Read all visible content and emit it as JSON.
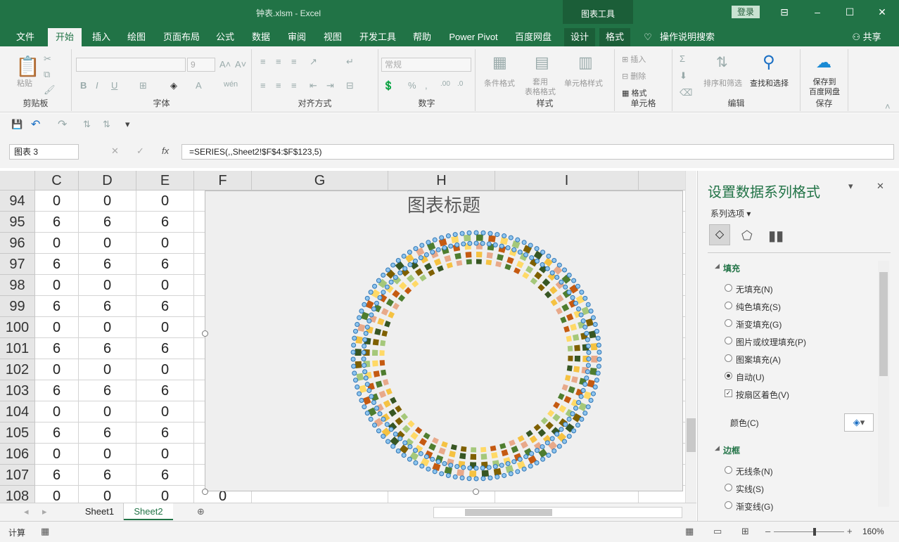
{
  "window": {
    "title": "钟表.xlsm  -  Excel",
    "chart_tools": "图表工具",
    "login": "登录"
  },
  "tabs": [
    "文件",
    "开始",
    "插入",
    "绘图",
    "页面布局",
    "公式",
    "数据",
    "审阅",
    "视图",
    "开发工具",
    "帮助",
    "Power Pivot",
    "百度网盘",
    "设计",
    "格式"
  ],
  "tell_me": "操作说明搜索",
  "share": "共享",
  "ribbon": {
    "clipboard": {
      "label": "剪贴板",
      "paste": "粘贴"
    },
    "font": {
      "label": "字体",
      "size": "9"
    },
    "align": {
      "label": "对齐方式"
    },
    "number": {
      "label": "数字",
      "format": "常规"
    },
    "styles": {
      "label": "样式",
      "cond": "条件格式",
      "table": "套用\n表格格式",
      "cell": "单元格样式"
    },
    "cells": {
      "label": "单元格",
      "insert": "插入",
      "delete": "删除",
      "format": "格式"
    },
    "edit": {
      "label": "编辑",
      "sort": "排序和筛选",
      "find": "查找和选择"
    },
    "save": {
      "label": "保存",
      "btn": "保存到\n百度网盘"
    }
  },
  "namebox": "图表 3",
  "formula": "=SERIES(,,Sheet2!$F$4:$F$123,5)",
  "columns": [
    "C",
    "D",
    "E",
    "F",
    "G",
    "H",
    "I"
  ],
  "rows": [
    {
      "n": "94",
      "c": "0",
      "d": "0",
      "e": "0"
    },
    {
      "n": "95",
      "c": "6",
      "d": "6",
      "e": "6"
    },
    {
      "n": "96",
      "c": "0",
      "d": "0",
      "e": "0"
    },
    {
      "n": "97",
      "c": "6",
      "d": "6",
      "e": "6"
    },
    {
      "n": "98",
      "c": "0",
      "d": "0",
      "e": "0"
    },
    {
      "n": "99",
      "c": "6",
      "d": "6",
      "e": "6"
    },
    {
      "n": "100",
      "c": "0",
      "d": "0",
      "e": "0"
    },
    {
      "n": "101",
      "c": "6",
      "d": "6",
      "e": "6"
    },
    {
      "n": "102",
      "c": "0",
      "d": "0",
      "e": "0"
    },
    {
      "n": "103",
      "c": "6",
      "d": "6",
      "e": "6"
    },
    {
      "n": "104",
      "c": "0",
      "d": "0",
      "e": "0"
    },
    {
      "n": "105",
      "c": "6",
      "d": "6",
      "e": "6"
    },
    {
      "n": "106",
      "c": "0",
      "d": "0",
      "e": "0"
    },
    {
      "n": "107",
      "c": "6",
      "d": "6",
      "e": "6"
    },
    {
      "n": "108",
      "c": "0",
      "d": "0",
      "e": "0",
      "f": "0"
    }
  ],
  "chart": {
    "title": "图表标题"
  },
  "sheets": [
    "Sheet1",
    "Sheet2"
  ],
  "status": {
    "mode": "计算",
    "zoom": "160%"
  },
  "pane": {
    "title": "设置数据系列格式",
    "series_options": "系列选项",
    "fill_section": "填充",
    "fill_options": [
      "无填充(N)",
      "纯色填充(S)",
      "渐变填充(G)",
      "图片或纹理填充(P)",
      "图案填充(A)",
      "自动(U)"
    ],
    "vary": "按扇区着色(V)",
    "color": "颜色(C)",
    "border_section": "边框",
    "border_options": [
      "无线条(N)",
      "实线(S)",
      "渐变线(G)"
    ]
  },
  "colors": {
    "accent": "#217346"
  }
}
